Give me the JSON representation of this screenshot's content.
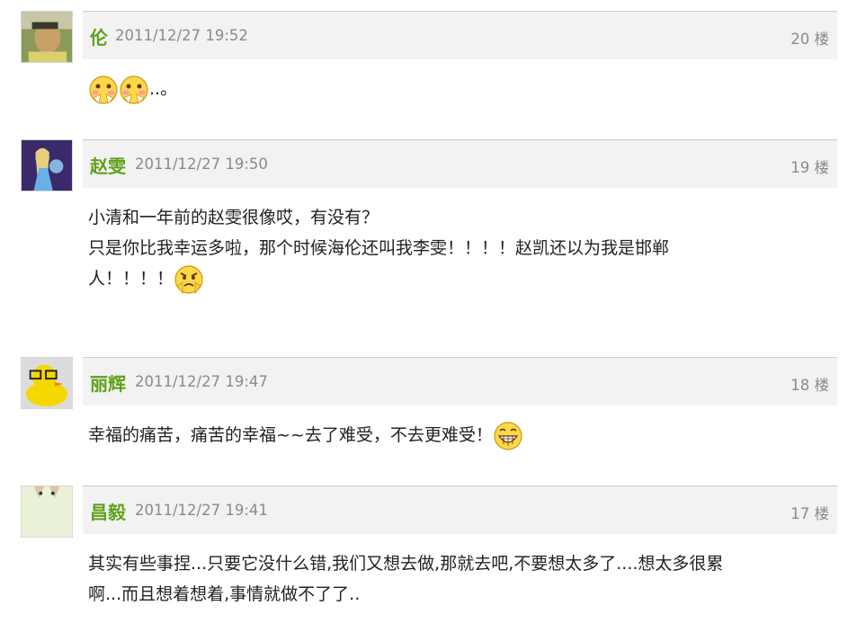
{
  "posts": [
    {
      "username": "伦",
      "time": "2011/12/27 19:52",
      "floor": "20 楼",
      "lines": [
        "..。"
      ],
      "emoticons": [
        "clap-blush-emoticon",
        "clap-blush-emoticon"
      ]
    },
    {
      "username": "赵雯",
      "time": "2011/12/27 19:50",
      "floor": "19 楼",
      "lines": [
        "小清和一年前的赵雯很像哎，有没有？",
        "只是你比我幸运多啦，那个时候海伦还叫我李雯！！！！赵凯还以为我是邯郸",
        "人！！！！"
      ],
      "emoticons": [
        "angry-emoticon"
      ]
    },
    {
      "username": "丽辉",
      "time": "2011/12/27 19:47",
      "floor": "18 楼",
      "lines": [
        "幸福的痛苦，痛苦的幸福~~去了难受，不去更难受！"
      ],
      "emoticons": [
        "grin-emoticon"
      ]
    },
    {
      "username": "昌毅",
      "time": "2011/12/27 19:41",
      "floor": "17 楼",
      "lines": [
        "其实有些事捏...只要它没什么错,我们又想去做,那就去吧,不要想太多了....想太多很累",
        "啊...而且想着想着,事情就做不了了.."
      ],
      "emoticons": []
    }
  ]
}
